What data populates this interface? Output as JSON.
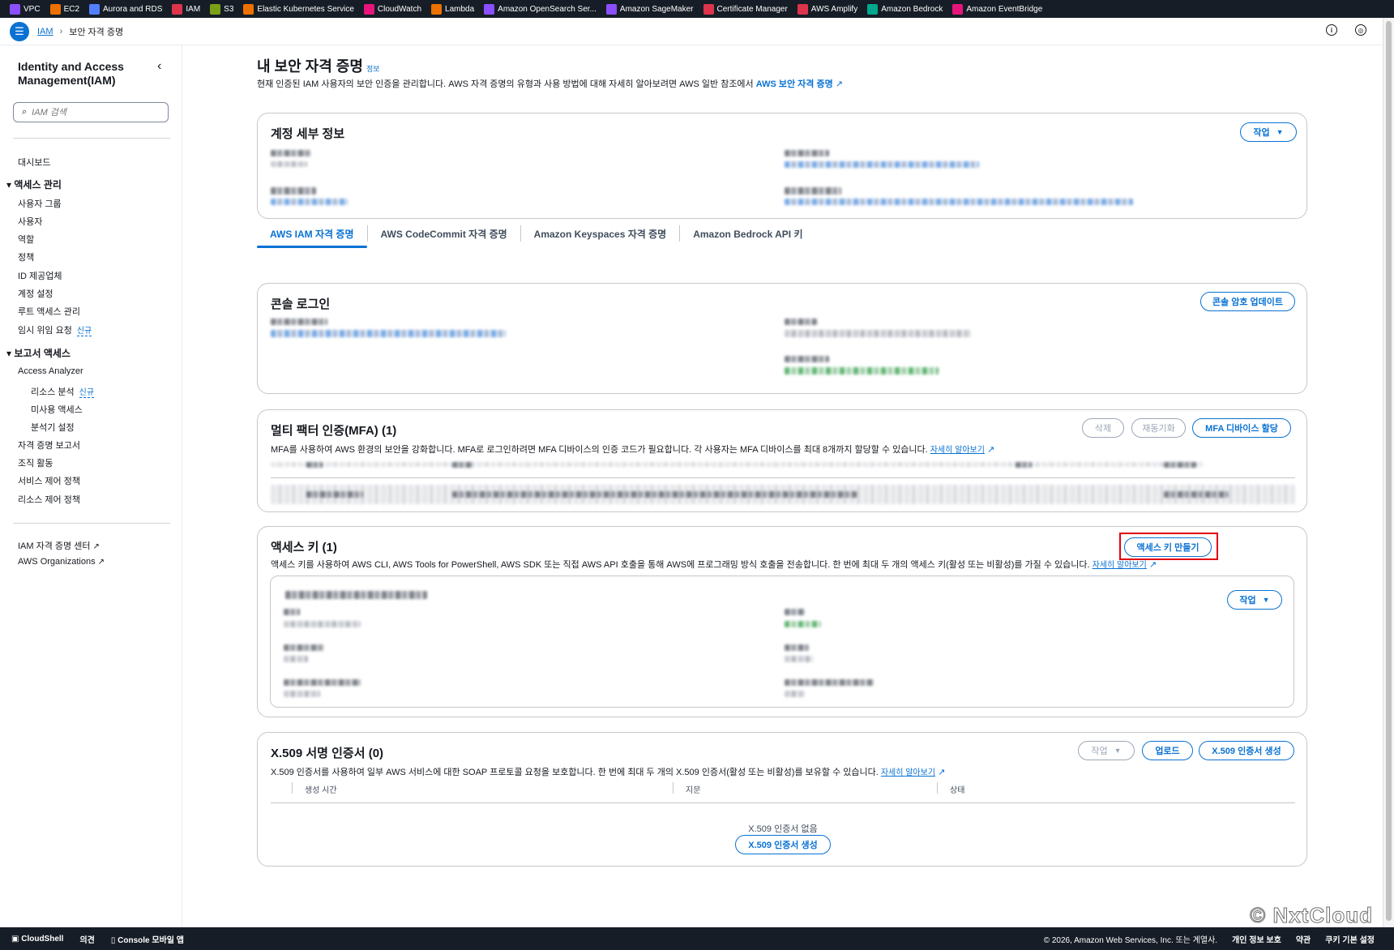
{
  "service_bar": [
    {
      "label": "VPC",
      "color": "#8c4fff"
    },
    {
      "label": "EC2",
      "color": "#ed7100"
    },
    {
      "label": "Aurora and RDS",
      "color": "#527fff"
    },
    {
      "label": "IAM",
      "color": "#dd344c"
    },
    {
      "label": "S3",
      "color": "#7aa116"
    },
    {
      "label": "Elastic Kubernetes Service",
      "color": "#ed7100"
    },
    {
      "label": "CloudWatch",
      "color": "#e7157b"
    },
    {
      "label": "Lambda",
      "color": "#ed7100"
    },
    {
      "label": "Amazon OpenSearch Ser...",
      "color": "#8c4fff"
    },
    {
      "label": "Amazon SageMaker",
      "color": "#8c4fff"
    },
    {
      "label": "Certificate Manager",
      "color": "#dd344c"
    },
    {
      "label": "AWS Amplify",
      "color": "#dd344c"
    },
    {
      "label": "Amazon Bedrock",
      "color": "#01a88d"
    },
    {
      "label": "Amazon EventBridge",
      "color": "#e7157b"
    }
  ],
  "breadcrumb": {
    "root": "IAM",
    "current": "보안 자격 증명"
  },
  "sidebar": {
    "title": "Identity and Access Management(IAM)",
    "search_placeholder": "IAM 검색",
    "dashboard": "대시보드",
    "section_access": "액세스 관리",
    "access_items": [
      "사용자 그룹",
      "사용자",
      "역할",
      "정책",
      "ID 제공업체",
      "계정 설정",
      "루트 액세스 관리",
      "임시 위임 요청"
    ],
    "new_badge": "신규",
    "section_report": "보고서 액세스",
    "analyzer": "Access Analyzer",
    "analyzer_items": [
      "리소스 분석",
      "미사용 액세스",
      "분석기 설정"
    ],
    "report_items": [
      "자격 증명 보고서",
      "조직 활동",
      "서비스 제어 정책",
      "리소스 제어 정책"
    ],
    "links": [
      "IAM 자격 증명 센터",
      "AWS Organizations"
    ]
  },
  "page": {
    "title": "내 보안 자격 증명",
    "info": "정보",
    "desc": "현재 인증된 IAM 사용자의 보안 인증을 관리합니다. AWS 자격 증명의 유형과 사용 방법에 대해 자세히 알아보려면 AWS 일반 참조에서",
    "desc_link": "AWS 보안 자격 증명"
  },
  "account_panel": {
    "title": "계정 세부 정보",
    "action": "작업"
  },
  "tabs": [
    "AWS IAM 자격 증명",
    "AWS CodeCommit 자격 증명",
    "Amazon Keyspaces 자격 증명",
    "Amazon Bedrock API 키"
  ],
  "console_panel": {
    "title": "콘솔 로그인",
    "action": "콘솔 암호 업데이트"
  },
  "mfa_panel": {
    "title": "멀티 팩터 인증(MFA) (1)",
    "desc": "MFA를 사용하여 AWS 환경의 보안을 강화합니다. MFA로 로그인하려면 MFA 디바이스의 인증 코드가 필요합니다. 각 사용자는 MFA 디바이스를 최대 8개까지 할당할 수 있습니다.",
    "learn_more": "자세히 알아보기",
    "buttons": {
      "delete": "삭제",
      "resync": "재동기화",
      "assign": "MFA 디바이스 할당"
    }
  },
  "access_key_panel": {
    "title": "액세스 키 (1)",
    "desc": "액세스 키를 사용하여 AWS CLI, AWS Tools for PowerShell, AWS SDK 또는 직접 AWS API 호출을 통해 AWS에 프로그래밍 방식 호출을 전송합니다. 한 번에 최대 두 개의 액세스 키(활성 또는 비활성)를 가질 수 있습니다.",
    "learn_more": "자세히 알아보기",
    "create": "액세스 키 만들기",
    "action": "작업"
  },
  "x509_panel": {
    "title": "X.509 서명 인증서 (0)",
    "desc": "X.509 인증서를 사용하여 일부 AWS 서비스에 대한 SOAP 프로토콜 요청을 보호합니다. 한 번에 최대 두 개의 X.509 인증서(활성 또는 비활성)를 보유할 수 있습니다.",
    "learn_more": "자세히 알아보기",
    "action": "작업",
    "upload": "업로드",
    "create": "X.509 인증서 생성",
    "columns": [
      "생성 시간",
      "지문",
      "상태"
    ],
    "empty": "X.509 인증서 없음",
    "empty_create": "X.509 인증서 생성"
  },
  "footer": {
    "cloudshell": "CloudShell",
    "feedback": "의견",
    "mobile": "Console 모바일 앱",
    "copyright": "© 2026, Amazon Web Services, Inc. 또는 계열사.",
    "privacy": "개인 정보 보호",
    "terms": "약관",
    "cookies": "쿠키 기본 설정"
  },
  "watermark": "© NxtCloud"
}
